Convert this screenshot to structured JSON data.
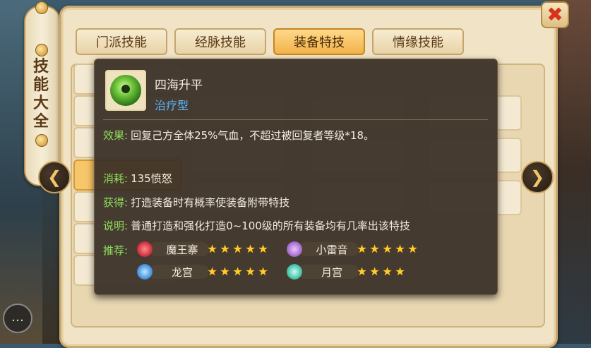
{
  "side_scroll": {
    "title_chars": [
      "技",
      "能",
      "大",
      "全"
    ]
  },
  "tabs": [
    {
      "label": "门派技能"
    },
    {
      "label": "经脉技能"
    },
    {
      "label": "装备特技"
    },
    {
      "label": "情缘技能"
    }
  ],
  "active_tab_index": 2,
  "close_button": {
    "icon": "close-icon",
    "glyph": "✖"
  },
  "nav": {
    "prev_glyph": "❮",
    "next_glyph": "❯"
  },
  "tooltip": {
    "icon": "skill-orb-icon",
    "name": "四海升平",
    "type": "治疗型",
    "effect_label": "效果:",
    "effect_text": "回复己方全体25%气血，不超过被回复者等级*18。",
    "cost_label": "消耗:",
    "cost_text": "135愤怒",
    "obtain_label": "获得:",
    "obtain_text": "打造装备时有概率使装备附带特技",
    "note_label": "说明:",
    "note_text": "普通打造和强化打造0~100级的所有装备均有几率出该特技",
    "recommend_label": "推荐:",
    "recommendations": [
      {
        "sect": "魔王寨",
        "stars": 5,
        "color": "#c8283a"
      },
      {
        "sect": "小雷音",
        "stars": 5,
        "color": "#a062c8"
      },
      {
        "sect": "龙宫",
        "stars": 5,
        "color": "#3a8ad8"
      },
      {
        "sect": "月宫",
        "stars": 4,
        "color": "#3ab8a0"
      }
    ]
  },
  "chat": {
    "icon": "chat-icon",
    "glyph": "…"
  }
}
